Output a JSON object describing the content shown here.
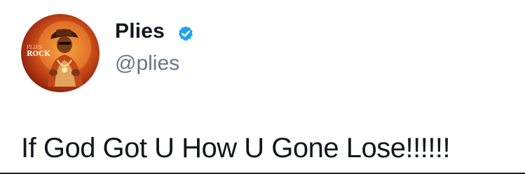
{
  "tweet": {
    "display_name": "Plies",
    "handle": "@plies",
    "verified": true,
    "text": "If God Got U How U Gone Lose!!!!!!",
    "avatar": {
      "overlay_text_line1": "PLIES",
      "overlay_text_line2": "ROCK"
    }
  },
  "icons": {
    "verified": "verified-badge-icon"
  },
  "colors": {
    "name": "#14171a",
    "handle": "#657786",
    "verified_blue": "#1da1f2",
    "text": "#14171a"
  }
}
